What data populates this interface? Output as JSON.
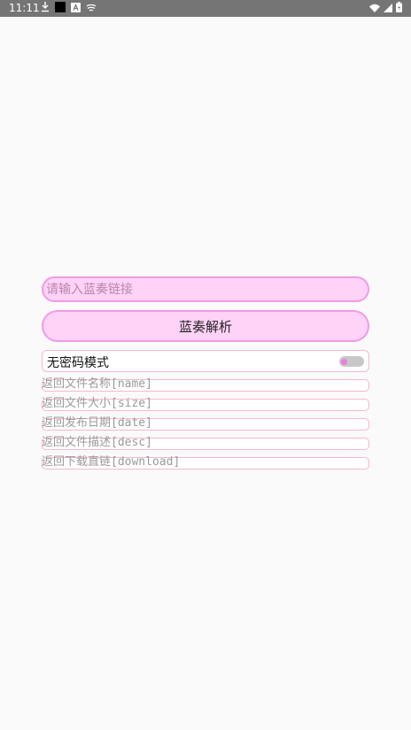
{
  "status_bar": {
    "time": "11:11",
    "left_icons": [
      "download-icon",
      "square-icon",
      "a-icon",
      "shield-icon"
    ],
    "right_icons": [
      "wifi-icon",
      "signal-icon",
      "battery-icon"
    ]
  },
  "form": {
    "link_input": {
      "value": "",
      "placeholder": "请输入蓝奏链接"
    },
    "parse_button_label": "蓝奏解析",
    "no_password_toggle": {
      "label": "无密码模式",
      "checked": false
    }
  },
  "results": [
    {
      "text": "返回文件名称[name]"
    },
    {
      "text": "返回文件大小[size]"
    },
    {
      "text": "返回发布日期[date]"
    },
    {
      "text": "返回文件描述[desc]"
    },
    {
      "text": "返回下载直链[download]"
    }
  ],
  "colors": {
    "status_bar": "#757575",
    "background": "#fafafa",
    "pink_fill": "#ffd2f7",
    "pink_border": "#f09be6",
    "light_pink_border": "#f4b9c7",
    "toggle_thumb": "#f07adf"
  }
}
